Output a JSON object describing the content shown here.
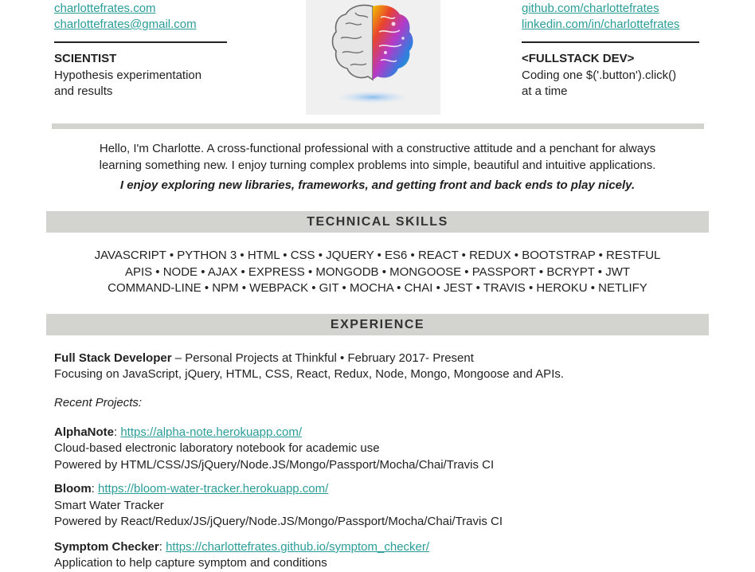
{
  "header": {
    "left": {
      "website": "charlottefrates.com",
      "email": "charlottefrates@gmail.com",
      "role_title": "SCIENTIST",
      "role_line1": "Hypothesis experimentation",
      "role_line2": "and results"
    },
    "right": {
      "github": "github.com/charlottefrates",
      "linkedin": "linkedin.com/in/charlottefrates",
      "role_title": "<FULLSTACK DEV>",
      "role_line1": "Coding one $('.button').click()",
      "role_line2": "at a time"
    }
  },
  "summary": {
    "line1": "Hello, I'm Charlotte. A cross-functional professional with a constructive attitude and a penchant for always",
    "line2": "learning something new. I enjoy turning complex problems into simple, beautiful and intuitive applications.",
    "line3": "I enjoy exploring new libraries, frameworks, and getting front and back ends to play nicely."
  },
  "skills": {
    "heading": "TECHNICAL SKILLS",
    "line1": "JAVASCRIPT • PYTHON 3 • HTML • CSS • JQUERY • ES6 • REACT • REDUX • BOOTSTRAP • RESTFUL",
    "line2": "APIS • NODE • AJAX • EXPRESS • MONGODB • MONGOOSE • PASSPORT • BCRYPT • JWT",
    "line3": "COMMAND-LINE • NPM • WEBPACK • GIT • MOCHA • CHAI • JEST • TRAVIS • HEROKU • NETLIFY"
  },
  "experience": {
    "heading": "EXPERIENCE",
    "job_title": "Full Stack Developer",
    "job_detail": " – Personal Projects at Thinkful • February 2017- Present",
    "job_focus": "Focusing on JavaScript, jQuery, HTML, CSS, React, Redux, Node, Mongo, Mongoose and APIs.",
    "recent_label": "Recent Projects:",
    "projects": [
      {
        "name": "AlphaNote",
        "url": "https://alpha-note.herokuapp.com/",
        "desc": "Cloud-based electronic laboratory notebook for academic use",
        "stack": "Powered by HTML/CSS/JS/jQuery/Node.JS/Mongo/Passport/Mocha/Chai/Travis CI"
      },
      {
        "name": "Bloom",
        "url": "https://bloom-water-tracker.herokuapp.com/",
        "desc": "Smart Water Tracker",
        "stack": "Powered by React/Redux/JS/jQuery/Node.JS/Mongo/Passport/Mocha/Chai/Travis CI"
      },
      {
        "name": "Symptom Checker",
        "url": "https://charlottefrates.github.io/symptom_checker/",
        "desc": "Application to help capture symptom and conditions"
      }
    ]
  },
  "icons": {
    "brain": "brain-illustration-icon"
  },
  "colors": {
    "link": "#2a9d99",
    "section_bar": "#d3d3d0",
    "brain_box": "#f0f0f0"
  }
}
